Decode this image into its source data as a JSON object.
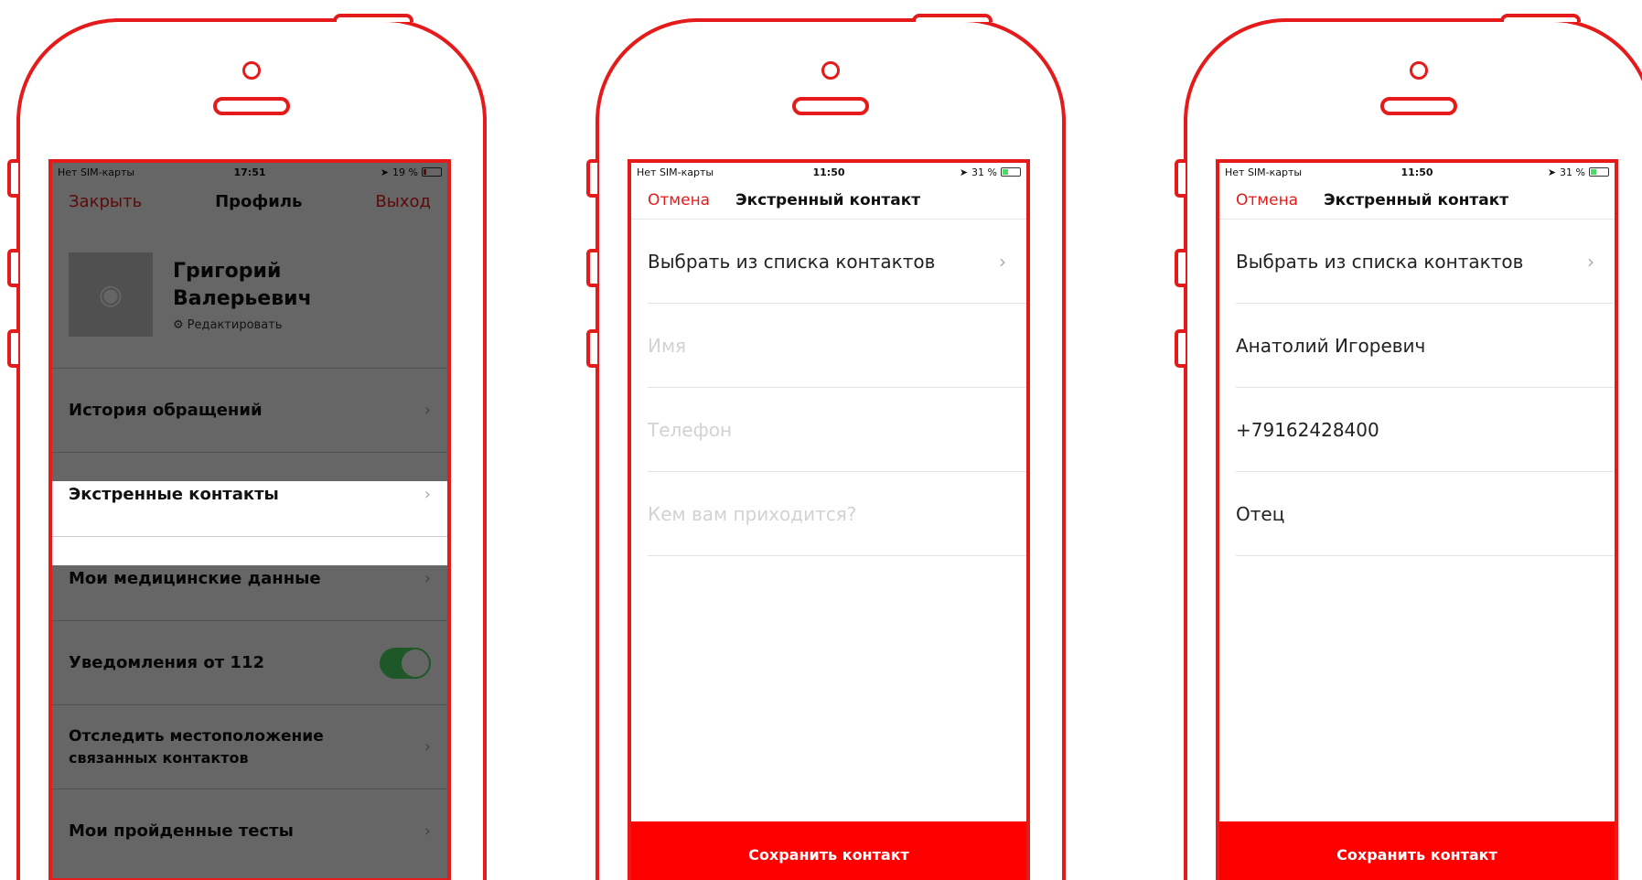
{
  "colors": {
    "accent": "#e51a1a",
    "save": "#ff0000",
    "toggle_on": "#4cd964"
  },
  "profile_screen": {
    "status": {
      "carrier": "Нет SIM-карты",
      "time": "17:51",
      "battery": "19 %"
    },
    "nav": {
      "left": "Закрыть",
      "title": "Профиль",
      "right": "Выход"
    },
    "user": {
      "first_name": "Григорий",
      "patronymic": "Валерьевич",
      "edit_label": "Редактировать"
    },
    "menu": [
      {
        "label": "История обращений"
      },
      {
        "label": "Экстренные контакты"
      },
      {
        "label": "Мои медицинские данные"
      },
      {
        "label": "Уведомления от 112",
        "toggle": true
      },
      {
        "label_line1": "Отследить местоположение",
        "label_line2": "связанных контактов"
      },
      {
        "label": "Мои пройденные тесты"
      }
    ]
  },
  "contact_empty": {
    "status": {
      "carrier": "Нет SIM-карты",
      "time": "11:50",
      "battery": "31 %"
    },
    "nav": {
      "cancel": "Отмена",
      "title": "Экстренный контакт"
    },
    "pick_label": "Выбрать из списка контактов",
    "fields": {
      "name_placeholder": "Имя",
      "phone_placeholder": "Телефон",
      "relation_placeholder": "Кем вам приходится?"
    },
    "save_label": "Сохранить контакт"
  },
  "contact_filled": {
    "status": {
      "carrier": "Нет SIM-карты",
      "time": "11:50",
      "battery": "31 %"
    },
    "nav": {
      "cancel": "Отмена",
      "title": "Экстренный контакт"
    },
    "pick_label": "Выбрать из списка контактов",
    "fields": {
      "name_value": "Анатолий Игоревич",
      "phone_value": "+79162428400",
      "relation_value": "Отец"
    },
    "save_label": "Сохранить контакт"
  }
}
